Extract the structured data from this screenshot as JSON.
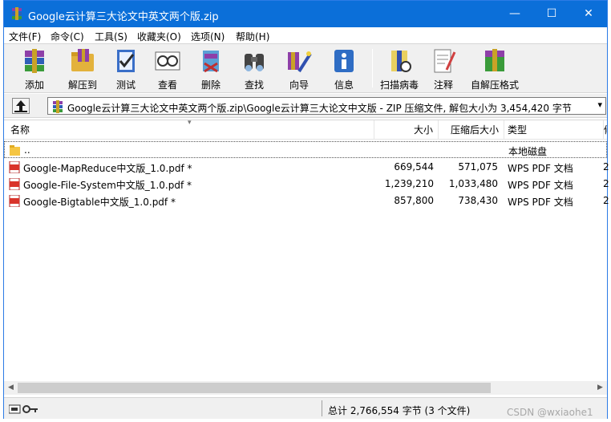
{
  "window": {
    "title": "Google云计算三大论文中英文两个版.zip",
    "minimize_glyph": "—",
    "maximize_glyph": "☐",
    "close_glyph": "✕"
  },
  "menu": [
    "文件(F)",
    "命令(C)",
    "工具(S)",
    "收藏夹(O)",
    "选项(N)",
    "帮助(H)"
  ],
  "toolbar": [
    {
      "label": "添加",
      "icon": "add-archive-icon"
    },
    {
      "label": "解压到",
      "icon": "extract-to-icon"
    },
    {
      "label": "测试",
      "icon": "test-icon"
    },
    {
      "label": "查看",
      "icon": "view-icon"
    },
    {
      "label": "删除",
      "icon": "delete-icon"
    },
    {
      "label": "查找",
      "icon": "find-icon"
    },
    {
      "label": "向导",
      "icon": "wizard-icon"
    },
    {
      "label": "信息",
      "icon": "info-icon"
    },
    {
      "label": "扫描病毒",
      "icon": "virus-scan-icon"
    },
    {
      "label": "注释",
      "icon": "comment-icon"
    },
    {
      "label": "自解压格式",
      "icon": "sfx-icon"
    }
  ],
  "address": {
    "path": "Google云计算三大论文中英文两个版.zip\\Google云计算三大论文中文版 - ZIP 压缩文件, 解包大小为 3,454,420 字节"
  },
  "columns": {
    "name": "名称",
    "size": "大小",
    "packed": "压缩后大小",
    "type": "类型",
    "extra": "修"
  },
  "rows": [
    {
      "name": "..",
      "size": "",
      "packed": "",
      "type": "本地磁盘",
      "extra": "",
      "icon": "folder-icon"
    },
    {
      "name": "Google-MapReduce中文版_1.0.pdf *",
      "size": "669,544",
      "packed": "571,075",
      "type": "WPS PDF 文档",
      "extra": "2",
      "icon": "pdf-file-icon"
    },
    {
      "name": "Google-File-System中文版_1.0.pdf *",
      "size": "1,239,210",
      "packed": "1,033,480",
      "type": "WPS PDF 文档",
      "extra": "2",
      "icon": "pdf-file-icon"
    },
    {
      "name": "Google-Bigtable中文版_1.0.pdf *",
      "size": "857,800",
      "packed": "738,430",
      "type": "WPS PDF 文档",
      "extra": "2",
      "icon": "pdf-file-icon"
    }
  ],
  "status": {
    "text": "总计 2,766,554 字节 (3 个文件)"
  },
  "watermark": "CSDN @wxiaohe1",
  "colors": {
    "titlebar": "#0b6fd9",
    "pdf_icon": "#d9342b",
    "folder": "#f5c542"
  }
}
